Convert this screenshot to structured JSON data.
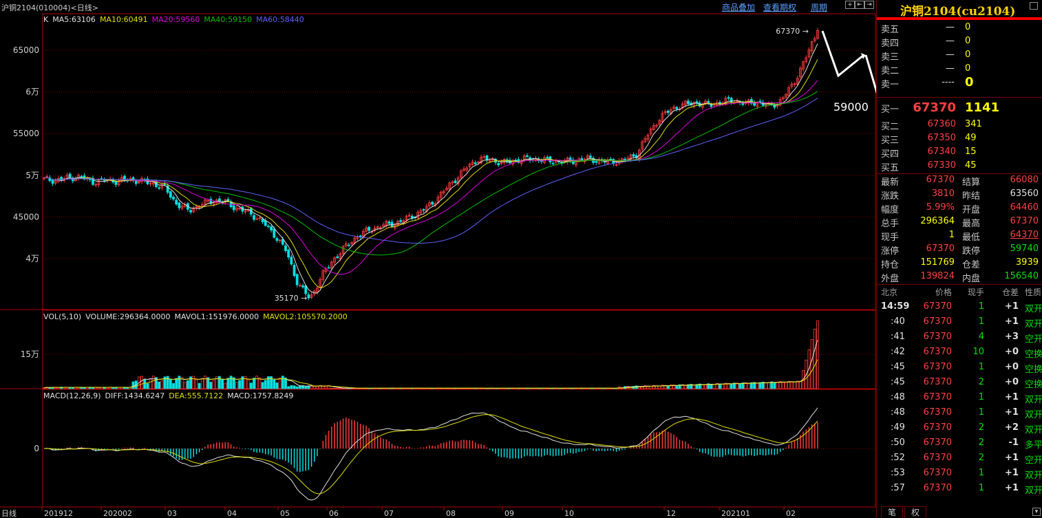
{
  "window": {
    "title": "沪铜2104(010004)<日线>"
  },
  "toolbar": {
    "overlay_label": "商品叠加",
    "history_label": "查看期权",
    "period_label": "周期"
  },
  "colors": {
    "up": "#ff3c3c",
    "down": "#00e0e0",
    "ma5": "#e0e0e0",
    "ma10": "#e0e000",
    "ma20": "#e000e0",
    "ma40": "#00c000",
    "ma60": "#6060ff",
    "grid": "#7a0000"
  },
  "main_panel": {
    "legend": [
      {
        "key": "K",
        "text": "K",
        "color": "#e0e0e0"
      },
      {
        "key": "MA5",
        "text": "MA5:63106",
        "color": "#e0e0e0"
      },
      {
        "key": "MA10",
        "text": "MA10:60491",
        "color": "#e0e000"
      },
      {
        "key": "MA20",
        "text": "MA20:59560",
        "color": "#e000e0"
      },
      {
        "key": "MA40",
        "text": "MA40:59150",
        "color": "#00c000"
      },
      {
        "key": "MA60",
        "text": "MA60:58440",
        "color": "#6060ff"
      }
    ],
    "high_label": "67370",
    "low_label": "35170",
    "annotation": "59000"
  },
  "vol_panel": {
    "legend": [
      {
        "text": "VOL(5,10)",
        "color": "#e0e0e0"
      },
      {
        "text": "VOLUME:296364.0000",
        "color": "#e0e0e0"
      },
      {
        "text": "MAVOL1:151976.0000",
        "color": "#e0e0e0"
      },
      {
        "text": "MAVOL2:105570.2000",
        "color": "#e0e000"
      }
    ]
  },
  "macd_panel": {
    "legend": [
      {
        "text": "MACD(12,26,9)",
        "color": "#e0e0e0"
      },
      {
        "text": "DIFF:1434.6247",
        "color": "#e0e0e0"
      },
      {
        "text": "DEA:555.7122",
        "color": "#e0e000"
      },
      {
        "text": "MACD:1757.8249",
        "color": "#e0e0e0"
      }
    ]
  },
  "chart_data": {
    "type": "candlestick",
    "title": "沪铜2104(010004)<日线>",
    "price_axis": {
      "ticks": [
        "65000",
        "6万",
        "55000",
        "5万",
        "45000",
        "4万"
      ],
      "ylim": [
        40000,
        67370
      ]
    },
    "vol_axis": {
      "ticks": [
        "15万"
      ]
    },
    "macd_axis": {
      "ticks": [
        "0"
      ]
    },
    "x_ticks": [
      "日线",
      "201912",
      "202002",
      "03",
      "04",
      "05",
      "06",
      "07",
      "08",
      "09",
      "10",
      "12",
      "202101",
      "02"
    ],
    "close_series": [
      49500,
      49400,
      49700,
      49800,
      49200,
      49400,
      49300,
      49500,
      49300,
      49000,
      48500,
      46500,
      45800,
      46500,
      47000,
      46800,
      46000,
      45500,
      44500,
      43000,
      41000,
      37000,
      35170,
      38000,
      40000,
      41500,
      42800,
      43500,
      44000,
      44200,
      44800,
      45500,
      46500,
      48000,
      49500,
      51000,
      52000,
      51800,
      51500,
      51800,
      52000,
      51900,
      51700,
      51600,
      51800,
      52000,
      51700,
      51600,
      51800,
      52500,
      55000,
      57000,
      58000,
      58500,
      58700,
      58400,
      58800,
      59000,
      58600,
      58800,
      58200,
      59000,
      61000,
      64000,
      67370
    ],
    "ma5_last": 63106,
    "ma10_last": 60491,
    "ma20_last": 59560,
    "ma40_last": 59150,
    "ma60_last": 58440,
    "high": 67370,
    "low": 35170,
    "volume_last": 296364,
    "mavol1": 151976,
    "mavol2": 105570.2,
    "diff": 1434.6247,
    "dea": 555.7122,
    "macd": 1757.8249
  },
  "quote": {
    "title": "沪铜2104(cu2104)",
    "asks": [
      {
        "label": "卖五",
        "price": "—",
        "vol": "0"
      },
      {
        "label": "卖四",
        "price": "—",
        "vol": "0"
      },
      {
        "label": "卖三",
        "price": "—",
        "vol": "0"
      },
      {
        "label": "卖二",
        "price": "—",
        "vol": "0"
      },
      {
        "label": "卖一",
        "price": "----",
        "vol": "0"
      }
    ],
    "bids": [
      {
        "label": "买一",
        "price": "67370",
        "vol": "1141"
      },
      {
        "label": "买二",
        "price": "67360",
        "vol": "341"
      },
      {
        "label": "买三",
        "price": "67350",
        "vol": "49"
      },
      {
        "label": "买四",
        "price": "67340",
        "vol": "15"
      },
      {
        "label": "买五",
        "price": "67330",
        "vol": "45"
      }
    ],
    "stats": [
      {
        "l1": "最新",
        "v1": "67370",
        "c1": "red",
        "l2": "结算",
        "v2": "66080",
        "c2": "red"
      },
      {
        "l1": "涨跌",
        "v1": "3810",
        "c1": "red",
        "l2": "昨结",
        "v2": "63560",
        "c2": "wht"
      },
      {
        "l1": "幅度",
        "v1": "5.99%",
        "c1": "red",
        "l2": "开盘",
        "v2": "64460",
        "c2": "red"
      },
      {
        "l1": "总手",
        "v1": "296364",
        "c1": "yel",
        "l2": "最高",
        "v2": "67370",
        "c2": "red"
      },
      {
        "l1": "现手",
        "v1": "1",
        "c1": "yel",
        "l2": "最低",
        "v2": "64370",
        "c2": "red"
      },
      {
        "l1": "涨停",
        "v1": "67370",
        "c1": "red",
        "l2": "跌停",
        "v2": "59740",
        "c2": "grn"
      },
      {
        "l1": "持仓",
        "v1": "151769",
        "c1": "yel",
        "l2": "仓差",
        "v2": "3939",
        "c2": "yel"
      },
      {
        "l1": "外盘",
        "v1": "139824",
        "c1": "red",
        "l2": "内盘",
        "v2": "156540",
        "c2": "grn"
      }
    ],
    "tick_headers": [
      "北京",
      "价格",
      "现手",
      "仓差",
      "性质"
    ],
    "ticks": [
      {
        "time": "14:59",
        "price": "67370",
        "vol": "1",
        "diff": "+1",
        "nature": "双开"
      },
      {
        "time": ":40",
        "price": "67370",
        "vol": "1",
        "diff": "+1",
        "nature": "双开"
      },
      {
        "time": ":41",
        "price": "67370",
        "vol": "4",
        "diff": "+3",
        "nature": "空开"
      },
      {
        "time": ":42",
        "price": "67370",
        "vol": "10",
        "diff": "+0",
        "nature": "空换"
      },
      {
        "time": ":45",
        "price": "67370",
        "vol": "1",
        "diff": "+0",
        "nature": "空换"
      },
      {
        "time": ":45",
        "price": "67370",
        "vol": "2",
        "diff": "+0",
        "nature": "空换"
      },
      {
        "time": ":48",
        "price": "67370",
        "vol": "1",
        "diff": "+1",
        "nature": "双开"
      },
      {
        "time": ":48",
        "price": "67370",
        "vol": "1",
        "diff": "+1",
        "nature": "双开"
      },
      {
        "time": ":49",
        "price": "67370",
        "vol": "2",
        "diff": "+2",
        "nature": "双开"
      },
      {
        "time": ":50",
        "price": "67370",
        "vol": "2",
        "diff": "-1",
        "nature": "多平"
      },
      {
        "time": ":52",
        "price": "67370",
        "vol": "2",
        "diff": "+1",
        "nature": "空开"
      },
      {
        "time": ":53",
        "price": "67370",
        "vol": "1",
        "diff": "+1",
        "nature": "双开"
      },
      {
        "time": ":57",
        "price": "67370",
        "vol": "1",
        "diff": "+1",
        "nature": "双开"
      }
    ],
    "tabs": [
      "笔",
      "权"
    ]
  }
}
